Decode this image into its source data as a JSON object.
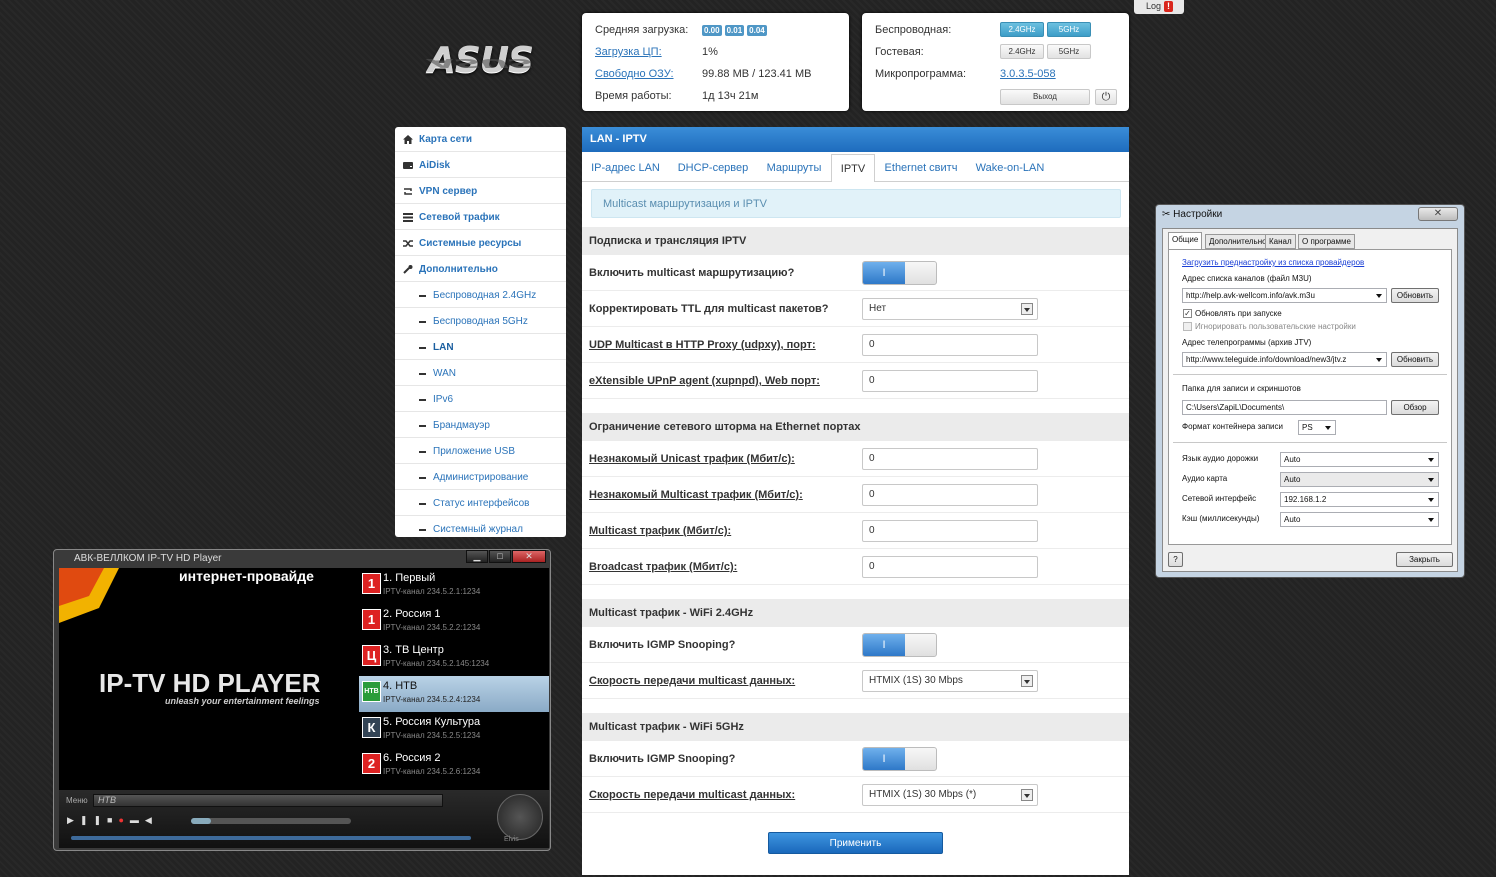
{
  "logo": {
    "text": "ASUS"
  },
  "log": {
    "label": "Log",
    "badge": "!"
  },
  "status_left": {
    "avg_load_label": "Средняя загрузка:",
    "avg_load": [
      "0.00",
      "0.01",
      "0.04"
    ],
    "cpu_label": "Загрузка ЦП:",
    "cpu_value": "1%",
    "ram_label": "Свободно ОЗУ:",
    "ram_value": "99.88 MB / 123.41 MB",
    "uptime_label": "Время работы:",
    "uptime_value": "1д 13ч 21м"
  },
  "status_right": {
    "wireless_label": "Беспроводная:",
    "guest_label": "Гостевая:",
    "band_24": "2.4GHz",
    "band_5": "5GHz",
    "firmware_label": "Микропрограмма:",
    "firmware_value": "3.0.3.5-058",
    "logout": "Выход"
  },
  "sidebar": {
    "top_items": [
      "Карта сети",
      "AiDisk",
      "VPN сервер",
      "Сетевой трафик",
      "Системные ресурсы",
      "Дополнительно"
    ],
    "sub_items": [
      "Беспроводная 2.4GHz",
      "Беспроводная 5GHz",
      "LAN",
      "WAN",
      "IPv6",
      "Брандмауэр",
      "Приложение USB",
      "Администрирование",
      "Статус интерфейсов",
      "Системный журнал"
    ]
  },
  "main": {
    "header": "LAN - IPTV",
    "tabs": [
      "IP-адрес LAN",
      "DHCP-сервер",
      "Маршруты",
      "IPTV",
      "Ethernet свитч",
      "Wake-on-LAN"
    ],
    "note": "Multicast маршрутизация и IPTV",
    "sec1": "Подписка и трансляция IPTV",
    "rows1": [
      {
        "label": "Включить multicast маршрутизацию?",
        "value": "I"
      },
      {
        "label": "Корректировать TTL для multicast пакетов?",
        "value": "Нет"
      },
      {
        "label": "UDP Multicast в HTTP Proxy (udpxy), порт:",
        "value": "0"
      },
      {
        "label": "eXtensible UPnP agent (xupnpd), Web порт:",
        "value": "0"
      }
    ],
    "sec2": "Ограничение сетевого шторма на Ethernet портах",
    "rows2": [
      {
        "label": "Незнакомый Unicast трафик (Мбит/с):",
        "value": "0"
      },
      {
        "label": "Незнакомый Multicast трафик (Мбит/с):",
        "value": "0"
      },
      {
        "label": "Multicast трафик (Мбит/с):",
        "value": "0"
      },
      {
        "label": "Broadcast трафик (Мбит/с):",
        "value": "0"
      }
    ],
    "sec3": "Multicast трафик - WiFi 2.4GHz",
    "rows3": [
      {
        "label": "Включить IGMP Snooping?",
        "value": "I"
      },
      {
        "label": "Скорость передачи multicast данных:",
        "value": "HTMIX (1S) 30 Mbps"
      }
    ],
    "sec4": "Multicast трафик - WiFi 5GHz",
    "rows4": [
      {
        "label": "Включить IGMP Snooping?",
        "value": "I"
      },
      {
        "label": "Скорость передачи multicast данных:",
        "value": "HTMIX (1S) 30 Mbps (*)"
      }
    ],
    "apply": "Применить"
  },
  "settings": {
    "title": "Настройки",
    "close": "✕",
    "tabs": [
      "Общие",
      "Дополнительно",
      "Канал",
      "О программе"
    ],
    "preset_link": "Загрузить преднастройку из списка провайдеров",
    "m3u_label": "Адрес списка каналов (файл M3U)",
    "m3u_value": "http://help.avk-wellcom.info/avk.m3u",
    "refresh": "Обновить",
    "update_on_start": "Обновлять при запуске",
    "ignore_user": "Игнорировать пользовательские настройки",
    "epg_label": "Адрес телепрограммы (архив JTV)",
    "epg_value": "http://www.teleguide.info/download/new3/jtv.z",
    "folder_label": "Папка для записи и скриншотов",
    "folder_value": "C:\\Users\\ZapiL\\Documents\\",
    "browse": "Обзор",
    "container_label": "Формат контейнера записи",
    "container_value": "PS",
    "audio_track_label": "Язык аудио дорожки",
    "audio_track_value": "Auto",
    "audio_card_label": "Аудио карта",
    "audio_card_value": "Auto",
    "net_if_label": "Сетевой интерфейс",
    "net_if_value": "192.168.1.2",
    "cache_label": "Кэш (миллисекунды)",
    "cache_value": "Auto",
    "help": "?",
    "close_btn": "Закрыть"
  },
  "player": {
    "title": "АВК-ВЕЛЛКОМ IP-TV HD Player",
    "banner": "интернет-провайде",
    "logo_main": "IP-TV HD PLAYER",
    "logo_tag": "unleash your entertainment feelings",
    "channels": [
      {
        "num": "1",
        "name": "1. Первый",
        "sub": "IPTV-канал 234.5.2.1:1234"
      },
      {
        "num": "1",
        "name": "2. Россия 1",
        "sub": "IPTV-канал 234.5.2.2:1234"
      },
      {
        "num": "Ц",
        "name": "3. ТВ Центр",
        "sub": "IPTV-канал 234.5.2.145:1234"
      },
      {
        "num": "НТВ",
        "name": "4. НТВ",
        "sub": "IPTV-канал 234.5.2.4:1234"
      },
      {
        "num": "К",
        "name": "5. Россия Культура",
        "sub": "IPTV-канал 234.5.2.5:1234"
      },
      {
        "num": "2",
        "name": "6. Россия 2",
        "sub": "IPTV-канал 234.5.2.6:1234"
      }
    ],
    "menu_label": "Меню",
    "current": "НТВ",
    "brand": "Elvis"
  }
}
